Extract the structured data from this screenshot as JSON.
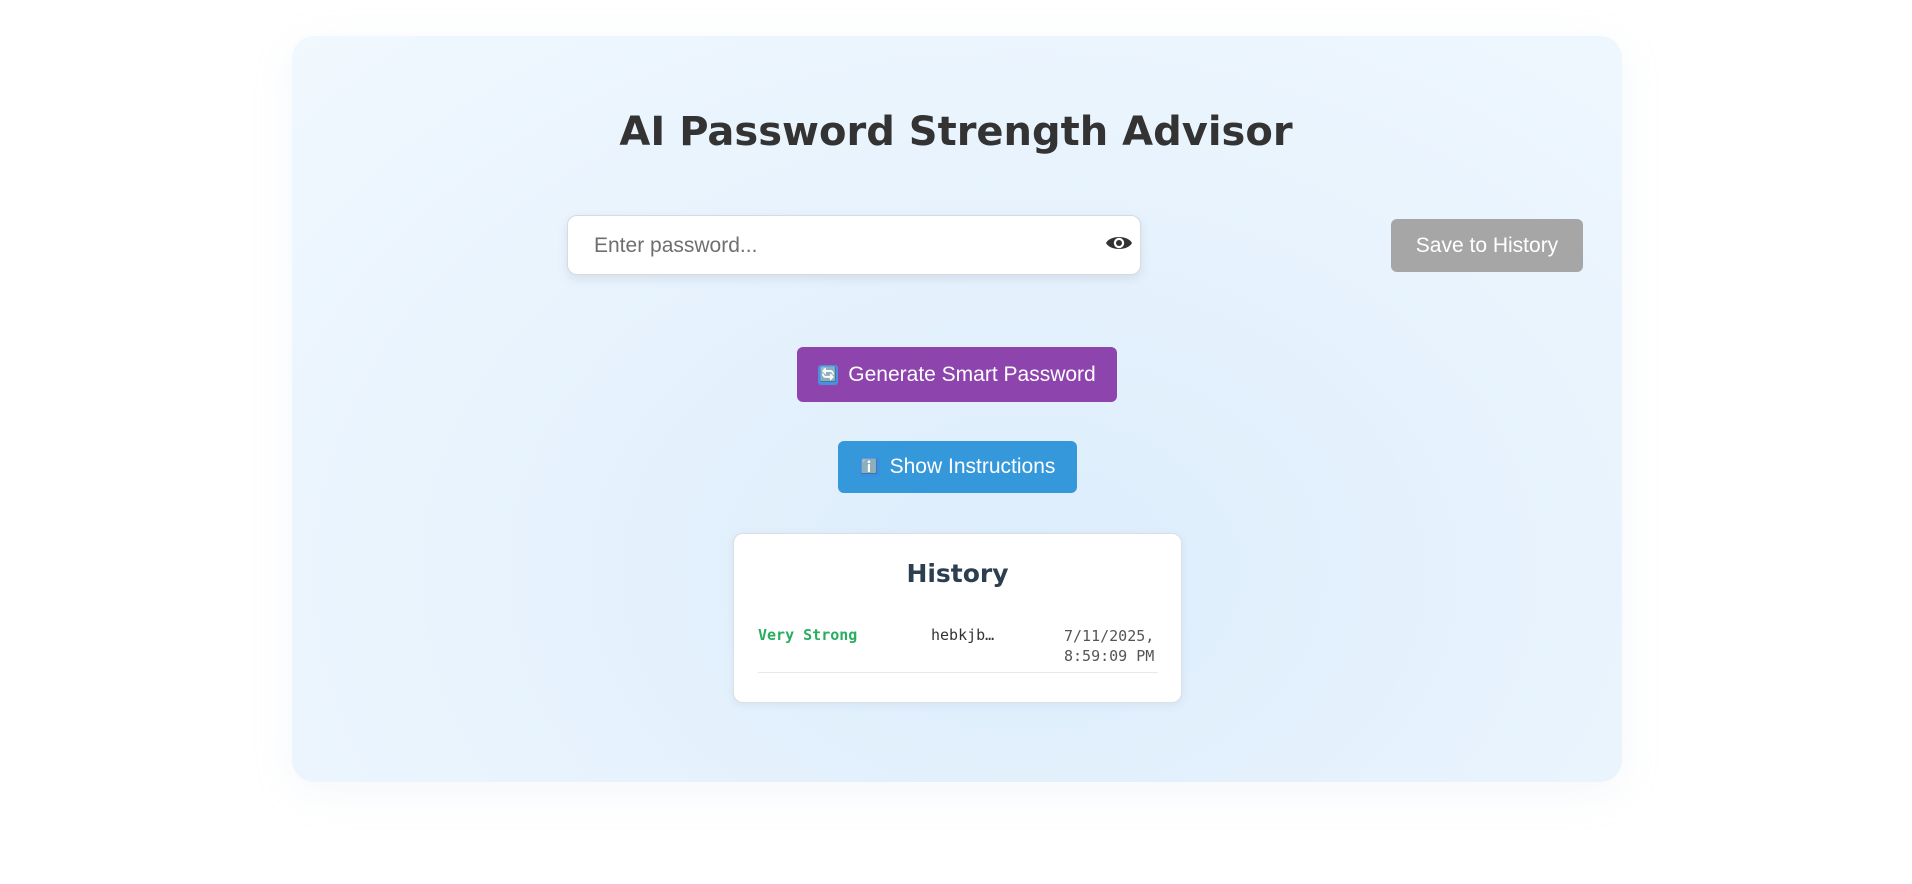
{
  "app": {
    "title": "AI Password Strength Advisor"
  },
  "password_field": {
    "placeholder": "Enter password...",
    "value": "",
    "toggle_icon": "eye-icon"
  },
  "buttons": {
    "save": "Save to History",
    "generate": "Generate Smart Password",
    "generate_icon": "🔄",
    "instructions": "Show Instructions",
    "instructions_icon": "ℹ️"
  },
  "history": {
    "title": "History",
    "entries": [
      {
        "strength": "Very Strong",
        "password": "hebkjb…",
        "time_line1": "7/11/2025,",
        "time_line2": "8:59:09 PM"
      }
    ]
  },
  "colors": {
    "save_button": "#a6a6a6",
    "generate_button": "#8e44ad",
    "instructions_button": "#3498db",
    "strength_very_strong": "#27ae60",
    "title_text": "#333333"
  }
}
